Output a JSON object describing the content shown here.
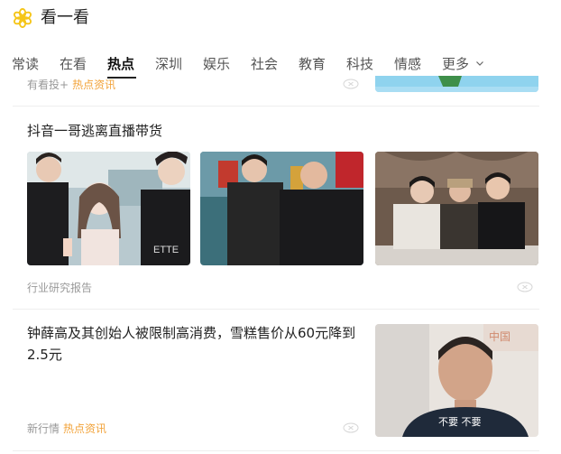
{
  "app": {
    "title": "看一看",
    "logo_icon": "flower-logo-icon",
    "accent": "#f5c518"
  },
  "tabs": [
    {
      "label": "常读"
    },
    {
      "label": "在看"
    },
    {
      "label": "热点",
      "active": true
    },
    {
      "label": "深圳"
    },
    {
      "label": "娱乐"
    },
    {
      "label": "社会"
    },
    {
      "label": "教育"
    },
    {
      "label": "科技"
    },
    {
      "label": "情感"
    },
    {
      "label": "更多"
    }
  ],
  "feed": [
    {
      "source": "有看投+",
      "tag": "热点资讯"
    },
    {
      "title": "抖音一哥逃离直播带货",
      "source": "行业研究报告",
      "images": [
        "three-men-phone-selfie",
        "two-men-festive-room",
        "group-men-restaurant"
      ]
    },
    {
      "title": "钟薛高及其创始人被限制高消费，雪糕售价从60元降到2.5元",
      "source": "新行情",
      "tag": "热点资讯",
      "image_caption": "不要 不要"
    }
  ],
  "colors": {
    "tag": "#f2a33a",
    "meta": "#999999",
    "divider": "#eeeeee",
    "active_tab": "#111111"
  }
}
